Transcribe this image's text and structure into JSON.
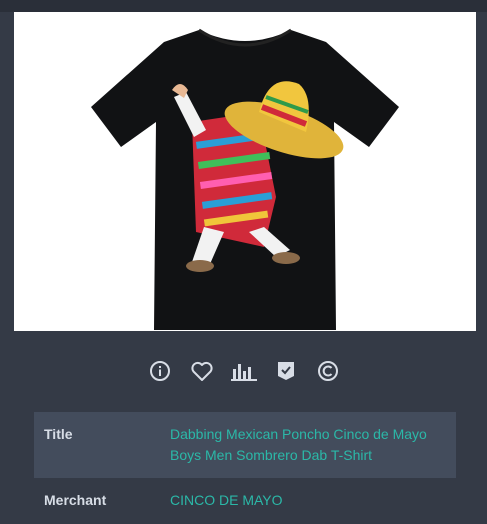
{
  "product": {
    "image_alt": "Dabbing Mexican Poncho Cinco de Mayo T-Shirt"
  },
  "actions": [
    {
      "name": "info-icon"
    },
    {
      "name": "heart-icon"
    },
    {
      "name": "bar-chart-icon"
    },
    {
      "name": "bookmark-check-icon"
    },
    {
      "name": "copyright-icon"
    }
  ],
  "details": {
    "title_label": "Title",
    "title_value": "Dabbing Mexican Poncho Cinco de Mayo Boys Men Sombrero Dab T-Shirt",
    "merchant_label": "Merchant",
    "merchant_value": "CINCO DE MAYO"
  },
  "colors": {
    "background": "#343a46",
    "accent": "#2bb8a8",
    "row_alt": "#434c5c"
  }
}
